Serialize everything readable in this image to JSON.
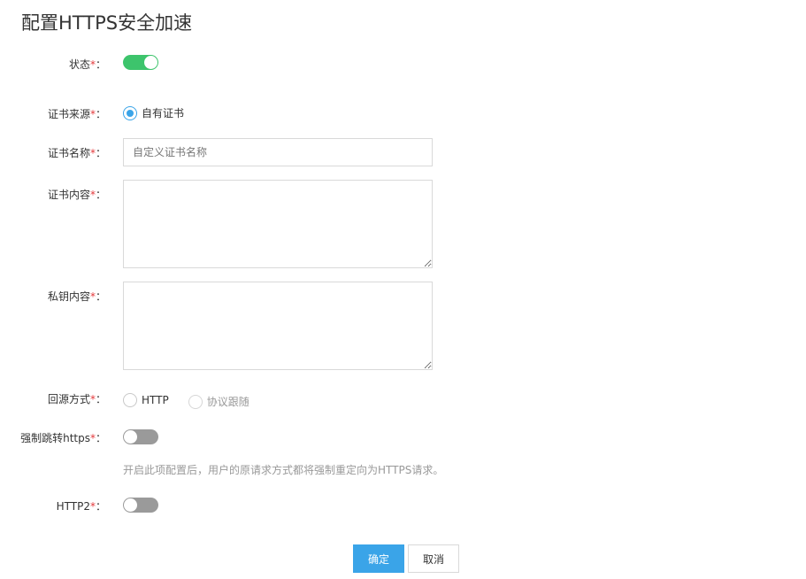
{
  "page": {
    "title": "配置HTTPS安全加速"
  },
  "form": {
    "status": {
      "label": "状态",
      "required_mark": "*",
      "colon": "：",
      "enabled": true
    },
    "cert_source": {
      "label": "证书来源",
      "required_mark": "*",
      "colon": "：",
      "options": [
        {
          "label": "自有证书",
          "checked": true
        }
      ]
    },
    "cert_name": {
      "label": "证书名称",
      "required_mark": "*",
      "colon": "：",
      "value": "",
      "placeholder": "自定义证书名称"
    },
    "cert_content": {
      "label": "证书内容",
      "required_mark": "*",
      "colon": "：",
      "value": ""
    },
    "private_key": {
      "label": "私钥内容",
      "required_mark": "*",
      "colon": "：",
      "value": ""
    },
    "origin_protocol": {
      "label": "回源方式",
      "required_mark": "*",
      "colon": "：",
      "options": [
        {
          "label": "HTTP",
          "checked": false,
          "disabled": false
        },
        {
          "label": "协议跟随",
          "checked": false,
          "disabled": true
        }
      ]
    },
    "force_https": {
      "label": "强制跳转https",
      "required_mark": "*",
      "colon": "：",
      "enabled": false,
      "hint": "开启此项配置后，用户的原请求方式都将强制重定向为HTTPS请求。"
    },
    "http2": {
      "label": "HTTP2",
      "required_mark": "*",
      "colon": "：",
      "enabled": false
    }
  },
  "actions": {
    "confirm_label": "确定",
    "cancel_label": "取消"
  },
  "colors": {
    "accent": "#3aa4e8",
    "toggle_on": "#3dc46c",
    "toggle_off": "#9a9a9a",
    "required": "#e4393c"
  },
  "icons": {
    "textarea_resize": "resize-grip-icon"
  }
}
